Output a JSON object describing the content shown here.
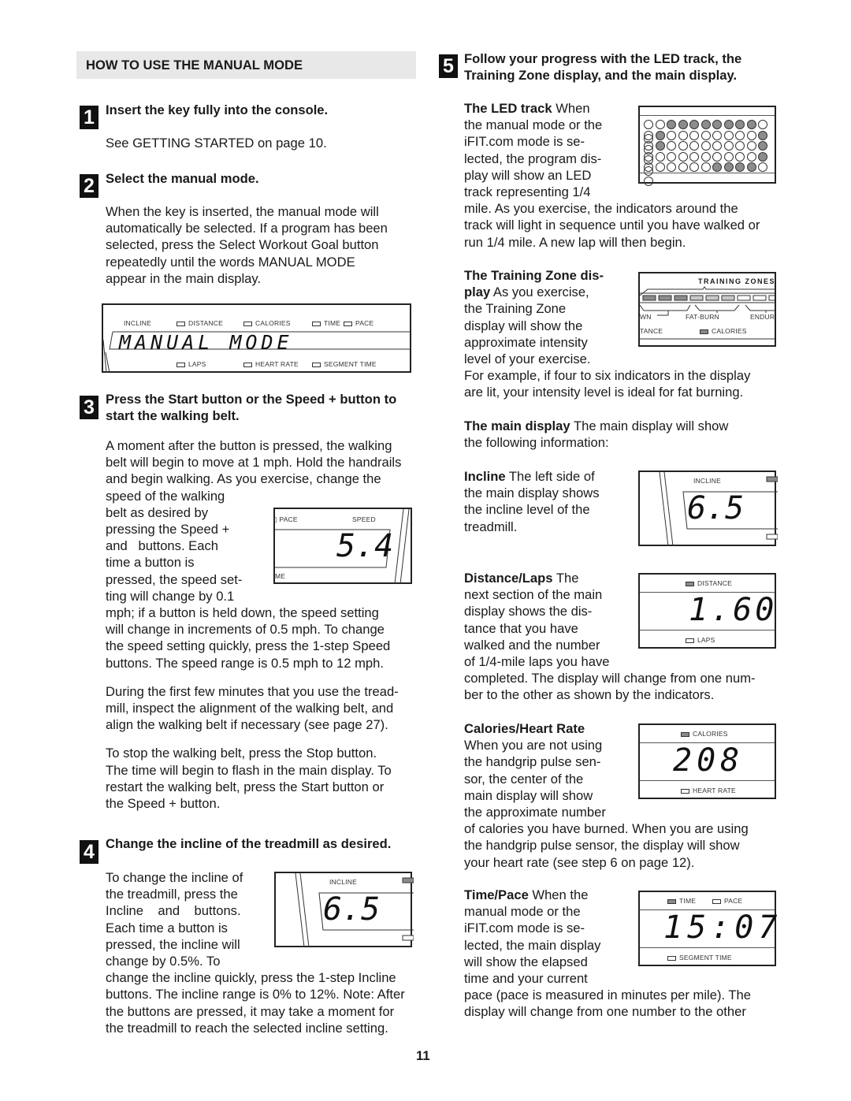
{
  "section_title": "HOW TO USE THE MANUAL MODE",
  "page_number": "11",
  "steps": [
    {
      "number": "1",
      "heading": "Insert the key fully into the console.",
      "paragraphs": [
        "See GETTING STARTED on page 10."
      ]
    },
    {
      "number": "2",
      "heading": "Select the manual mode.",
      "lines": [
        "When the key is inserted, the manual mode will",
        "automatically be selected. If a program has been",
        "selected, press the Select Workout Goal button",
        "repeatedly until the words  MANUAL MODE",
        "appear in the main display."
      ]
    },
    {
      "number": "3",
      "heading_lines": [
        "Press the Start button or the Speed + button to",
        "start the walking belt."
      ],
      "lines_full": [
        "A moment after the button is pressed, the walking",
        "belt will begin to move at 1 mph. Hold the handrails",
        "and begin walking. As you exercise, change the"
      ],
      "lines_narrow": [
        "speed of the walking",
        "belt as desired by",
        "pressing the Speed +",
        "and   buttons. Each",
        "time a button is",
        "pressed, the speed set-",
        "ting will change by 0.1"
      ],
      "lines_after": [
        "mph; if a button is held down, the speed setting",
        "will change in increments of 0.5 mph. To change",
        "the speed setting quickly, press the 1-step Speed",
        "buttons. The speed range is 0.5 mph to 12 mph."
      ],
      "para2": [
        "During the first few minutes that you use the tread-",
        "mill, inspect the alignment of the walking belt, and",
        "align the walking belt if necessary (see page 27)."
      ],
      "para3": [
        "To stop the walking belt, press the Stop button.",
        "The time will begin to flash in the main display. To",
        "restart the walking belt, press the Start button or",
        "the Speed + button."
      ]
    },
    {
      "number": "4",
      "heading": "Change the incline of the treadmill as desired.",
      "lines_narrow": [
        "To change the incline of",
        "the treadmill, press the",
        "Incline    and    buttons.",
        "Each time a button is",
        "pressed, the incline will",
        "change by 0.5%. To"
      ],
      "lines_after": [
        "change the incline quickly, press the 1-step Incline",
        "buttons. The incline range is 0% to 12%. Note: After",
        "the buttons are pressed, it may take a moment for",
        "the treadmill to reach the selected incline setting."
      ]
    },
    {
      "number": "5",
      "heading_lines": [
        "Follow your progress with the LED track, the",
        "Training Zone display, and the main display."
      ]
    }
  ],
  "led_track": {
    "title": "The LED track",
    "lines_narrow": [
      " When",
      "the manual mode or the",
      "iFIT.com mode is se-",
      "lected, the program dis-",
      "play will show an LED",
      "track representing 1/4"
    ],
    "lines_after": [
      "mile. As you exercise, the indicators around the",
      "track will light in sequence until you have walked or",
      "run 1/4 mile. A new lap will then begin."
    ],
    "grid": [
      [
        0,
        0,
        1,
        1,
        1,
        1,
        1,
        1,
        1,
        1,
        0,
        0
      ],
      [
        0,
        1,
        0,
        0,
        0,
        0,
        0,
        0,
        0,
        0,
        1,
        0
      ],
      [
        0,
        1,
        0,
        0,
        0,
        0,
        0,
        0,
        0,
        0,
        1,
        0
      ],
      [
        0,
        0,
        0,
        0,
        0,
        0,
        0,
        0,
        0,
        0,
        1,
        0
      ],
      [
        0,
        0,
        0,
        0,
        0,
        0,
        1,
        1,
        1,
        1,
        0,
        0
      ]
    ]
  },
  "training_zone": {
    "title_lines": [
      "The Training Zone dis-",
      "play"
    ],
    "lines_narrow_first": " As you exercise,",
    "lines_narrow": [
      "the Training Zone",
      "display will show the",
      "approximate intensity",
      "level of your exercise."
    ],
    "lines_after": [
      "For example, if four to six indicators in the display",
      "are lit, your intensity level is ideal for fat burning."
    ],
    "display": {
      "header": "TRAINING ZONES",
      "zones": [
        "WN",
        "FAT-BURN",
        "ENDURAI"
      ],
      "bottom_left": "TANCE",
      "bottom_indicator": "CALORIES",
      "segments": [
        2,
        2,
        2,
        1,
        1,
        1,
        0,
        0,
        0
      ]
    }
  },
  "main_display": {
    "title": "The main display",
    "lines": [
      " The main display will show",
      "the following information:"
    ]
  },
  "incline": {
    "title": "Incline",
    "lines": [
      " The left side of",
      "the main display shows",
      "the incline level of the",
      "treadmill."
    ],
    "label": "INCLINE",
    "value": "6.5"
  },
  "distance": {
    "title": "Distance/Laps",
    "lines": [
      " The",
      "next section of the main",
      "display shows the dis-",
      "tance that you have",
      "walked and the number",
      "of 1/4-mile laps you have"
    ],
    "lines_after": [
      "completed. The display will change from one num-",
      "ber to the other as shown by the indicators."
    ],
    "top_label": "DISTANCE",
    "bottom_label": "LAPS",
    "value": "1.60"
  },
  "calories": {
    "title": "Calories/Heart Rate",
    "lines": [
      "When you are not using",
      "the handgrip pulse sen-",
      "sor, the center of the",
      "main display will show",
      "the approximate number"
    ],
    "lines_after": [
      "of calories you have burned. When you are using",
      "the handgrip pulse sensor, the display will show",
      "your heart rate (see step 6 on page 12)."
    ],
    "top_label": "CALORIES",
    "bottom_label": "HEART RATE",
    "value": "208"
  },
  "time_pace": {
    "title": "Time/Pace",
    "lines": [
      " When the",
      "manual mode or the",
      "iFIT.com mode is se-",
      "lected, the main display",
      "will show the elapsed",
      "time and your current"
    ],
    "lines_after": [
      "pace (pace is measured in minutes per mile). The",
      "display will change from one number to the other"
    ],
    "label_time": "TIME",
    "label_pace": "PACE",
    "bottom_label": "SEGMENT TIME",
    "value": "15:07"
  },
  "manual_display": {
    "labels_top": [
      "INCLINE",
      "DISTANCE",
      "CALORIES",
      "TIME",
      "PACE"
    ],
    "labels_bottom": [
      "LAPS",
      "HEART RATE",
      "SEGMENT TIME"
    ],
    "text": "MANUAL MODE"
  },
  "speed_display": {
    "label_pace": "PACE",
    "label_speed": "SPEED",
    "label_time_partial": "ME",
    "value": "5.4"
  },
  "incline_display_step4": {
    "label": "INCLINE",
    "value": "6.5"
  }
}
